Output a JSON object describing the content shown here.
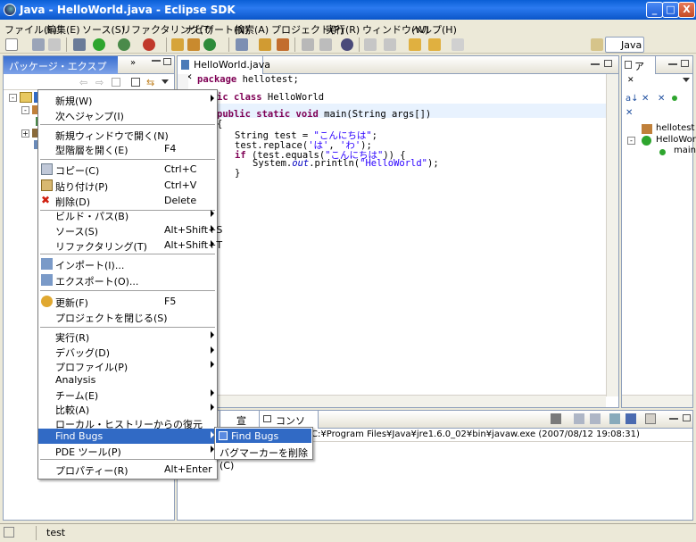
{
  "window": {
    "title": "Java - HelloWorld.java - Eclipse SDK",
    "min": "_",
    "max": "□",
    "close": "X"
  },
  "menubar": [
    "ファイル(F)",
    "編集(E)",
    "ソース(S)",
    "リファクタリング(T)",
    "ナビゲート(N)",
    "検索(A)",
    "プロジェクト(P)",
    "実行(R)",
    "ウィンドウ(W)",
    "ヘルプ(H)"
  ],
  "perspective": {
    "label": "Java"
  },
  "package_explorer": {
    "tab_label": "パッケージ・エクスプローラ",
    "close": "×"
  },
  "editor": {
    "tab_label": "HelloWorld.java",
    "close": "✕",
    "lines": {
      "l1_kw": "package",
      "l1_rest": " hellotest;",
      "l2_kw": "ic class",
      "l2_rest": " HelloWorld",
      "l3_kw": "public static void",
      "l3_rest": " main(String args[])",
      "l4_brace": "{",
      "l5a": "String test = ",
      "l5s": "\"こんにちは\"",
      "l5b": ";",
      "l6a": "test.replace(",
      "l6s1": "'は'",
      "l6m": ", ",
      "l6s2": "'わ'",
      "l6b": ");",
      "l7a": "if",
      "l7b": " (test.equals(",
      "l7s": "\"こんにちは\"",
      "l7c": ")) {",
      "l8a": "System.",
      "l8i": "out",
      "l8b": ".println(",
      "l8s": "\"HelloWorld\"",
      "l8c": ");",
      "l9": "}"
    }
  },
  "outline": {
    "tab_label": "ア",
    "items": [
      "hellotest",
      "HelloWorl",
      "main"
    ]
  },
  "console": {
    "tab_partial": "doc",
    "tab_decl": "宣言",
    "tab_console": "コンソール",
    "path_text": "C:¥Program Files¥Java¥jre1.6.0_02¥bin¥javaw.exe (2007/08/12 19:08:31)"
  },
  "context_menu": {
    "items": [
      {
        "label": "新規(W)",
        "shortcut": "",
        "submenu": true
      },
      {
        "label": "次へジャンプ(I)",
        "shortcut": "",
        "submenu": false
      },
      {
        "label": "新規ウィンドウで開く(N)",
        "shortcut": "",
        "submenu": false
      },
      {
        "label": "型階層を開く(E)",
        "shortcut": "F4",
        "submenu": false
      },
      {
        "label": "コピー(C)",
        "shortcut": "Ctrl+C",
        "submenu": false
      },
      {
        "label": "貼り付け(P)",
        "shortcut": "Ctrl+V",
        "submenu": false
      },
      {
        "label": "削除(D)",
        "shortcut": "Delete",
        "submenu": false
      },
      {
        "label": "ビルド・パス(B)",
        "shortcut": "",
        "submenu": true
      },
      {
        "label": "ソース(S)",
        "shortcut": "Alt+Shift+S",
        "submenu": true
      },
      {
        "label": "リファクタリング(T)",
        "shortcut": "Alt+Shift+T",
        "submenu": true
      },
      {
        "label": "インポート(I)...",
        "shortcut": "",
        "submenu": false
      },
      {
        "label": "エクスポート(O)...",
        "shortcut": "",
        "submenu": false
      },
      {
        "label": "更新(F)",
        "shortcut": "F5",
        "submenu": false
      },
      {
        "label": "プロジェクトを閉じる(S)",
        "shortcut": "",
        "submenu": false
      },
      {
        "label": "実行(R)",
        "shortcut": "",
        "submenu": true
      },
      {
        "label": "デバッグ(D)",
        "shortcut": "",
        "submenu": true
      },
      {
        "label": "プロファイル(P)",
        "shortcut": "",
        "submenu": true
      },
      {
        "label": "Analysis",
        "shortcut": "",
        "submenu": false
      },
      {
        "label": "チーム(E)",
        "shortcut": "",
        "submenu": true
      },
      {
        "label": "比較(A)",
        "shortcut": "",
        "submenu": true
      },
      {
        "label": "ローカル・ヒストリーからの復元(Y)...",
        "shortcut": "",
        "submenu": false
      },
      {
        "label": "Find Bugs",
        "shortcut": "",
        "submenu": true
      },
      {
        "label": "PDE ツール(P)",
        "shortcut": "",
        "submenu": true
      },
      {
        "label": "プロパティー(R)",
        "shortcut": "Alt+Enter",
        "submenu": false
      }
    ]
  },
  "submenu": {
    "items": [
      "Find Bugs",
      "バグマーカーを削除(C)"
    ]
  },
  "status": {
    "text": "test"
  }
}
